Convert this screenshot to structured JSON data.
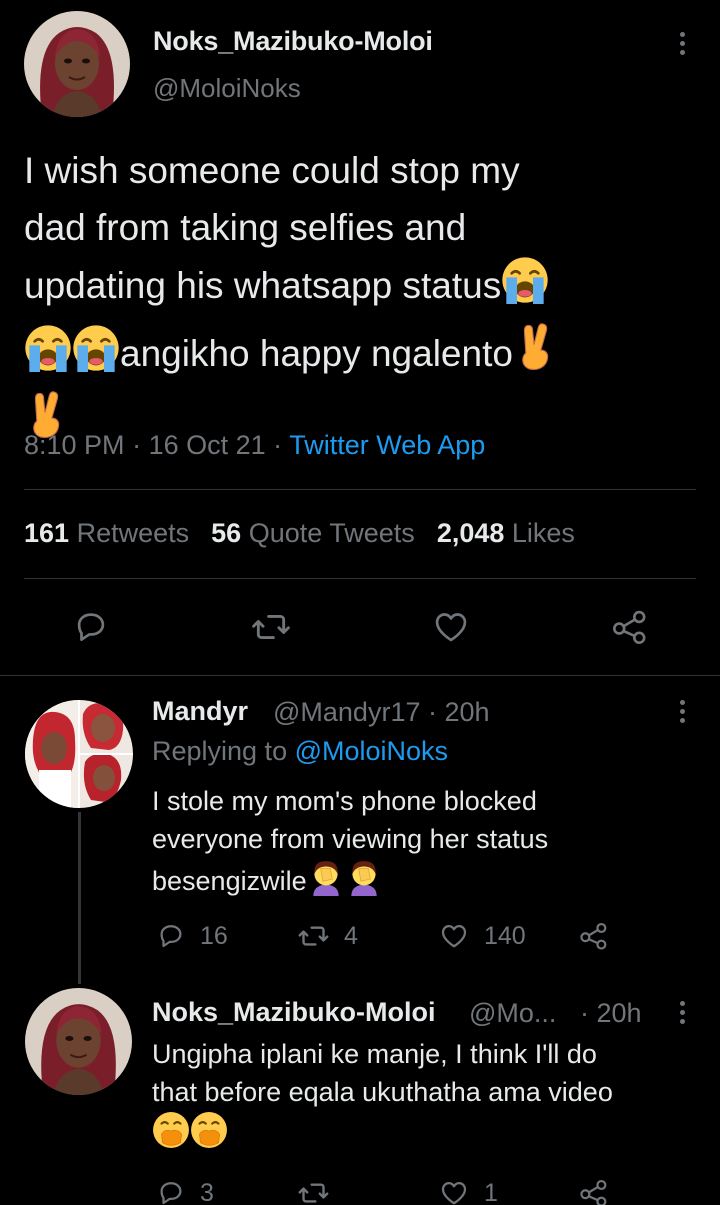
{
  "tweet": {
    "display_name": "Noks_Mazibuko-Moloi",
    "handle": "@MoloiNoks",
    "text_lines": [
      "I wish someone could stop my",
      "dad from taking selfies and",
      "updating his whatsapp status",
      "angikho happy ngalento"
    ],
    "time": "8:10 PM",
    "date": "16 Oct 21",
    "app": "Twitter Web App",
    "stats": {
      "retweets_count": "161",
      "retweets_label": "Retweets",
      "quotes_count": "56",
      "quotes_label": "Quote Tweets",
      "likes_count": "2,048",
      "likes_label": "Likes"
    }
  },
  "replies": [
    {
      "display_name": "Mandyr",
      "handle": "@Mandyr17",
      "age": "· 20h",
      "replying_prefix": "Replying to",
      "replying_to": "@MoloiNoks",
      "text_lines": [
        "I stole my mom's phone blocked",
        "everyone from viewing her status",
        "besengizwile"
      ],
      "reply_count": "16",
      "retweet_count": "4",
      "like_count": "140"
    },
    {
      "display_name": "Noks_Mazibuko-Moloi",
      "handle": "@Mo...",
      "age": "· 20h",
      "text_lines": [
        "Ungipha iplani ke manje, I think I'll do",
        "that before eqala ukuthatha ama video"
      ],
      "reply_count": "3",
      "retweet_count": "",
      "like_count": "1"
    }
  ],
  "icons": {
    "crying": "loudly-crying-face-emoji",
    "crossed": "crossed-fingers-emoji",
    "facepalm": "woman-facepalming-emoji",
    "mouth": "face-with-hand-over-mouth-emoji"
  },
  "colors": {
    "background": "#000000",
    "text": "#e7e9ea",
    "secondary": "#71767b",
    "accent": "#1d9bf0",
    "divider": "#2f3336"
  }
}
